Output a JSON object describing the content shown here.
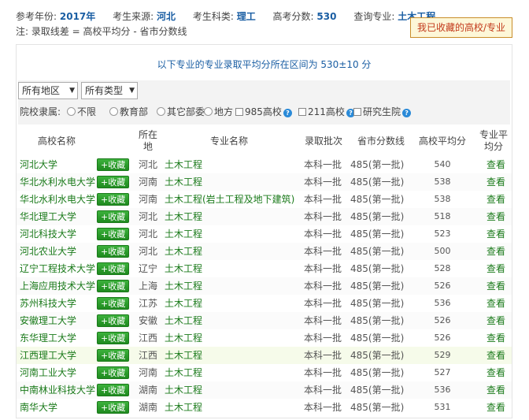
{
  "header": {
    "year_label": "参考年份:",
    "year_value": "2017年",
    "source_label": "考生来源:",
    "source_value": "河北",
    "subject_label": "考生科类:",
    "subject_value": "理工",
    "score_label": "高考分数:",
    "score_value": "530",
    "major_label": "查询专业:",
    "major_value": "土木工程",
    "note": "注: 录取线差 = 高校平均分 - 省市分数线",
    "favorites_button": "我已收藏的高校/专业"
  },
  "notice": "以下专业的专业录取平均分所在区间为  530±10  分",
  "filters": {
    "region_select": "所有地区",
    "type_select": "所有类型",
    "affiliation_label": "院校隶属:",
    "affiliation_options": [
      "不限",
      "教育部",
      "其它部委",
      "地方"
    ],
    "checkbox_985": "985高校",
    "checkbox_211": "211高校",
    "checkbox_grad": "研究生院"
  },
  "table": {
    "headers": {
      "school": "高校名称",
      "location": "所在地",
      "major": "专业名称",
      "batch": "录取批次",
      "province_line": "省市分数线",
      "school_avg": "高校平均分",
      "major_avg": "专业平均分"
    },
    "favorite_label": "+收藏",
    "rows": [
      {
        "school": "河北大学",
        "location": "河北",
        "major": "土木工程",
        "batch": "本科一批",
        "line": "485(第一批)",
        "avg": "540",
        "view": "查看"
      },
      {
        "school": "华北水利水电大学",
        "location": "河南",
        "major": "土木工程",
        "batch": "本科一批",
        "line": "485(第一批)",
        "avg": "538",
        "view": "查看"
      },
      {
        "school": "华北水利水电大学",
        "location": "河南",
        "major": "土木工程(岩土工程及地下建筑)",
        "batch": "本科一批",
        "line": "485(第一批)",
        "avg": "538",
        "view": "查看"
      },
      {
        "school": "华北理工大学",
        "location": "河北",
        "major": "土木工程",
        "batch": "本科一批",
        "line": "485(第一批)",
        "avg": "518",
        "view": "查看"
      },
      {
        "school": "河北科技大学",
        "location": "河北",
        "major": "土木工程",
        "batch": "本科一批",
        "line": "485(第一批)",
        "avg": "523",
        "view": "查看"
      },
      {
        "school": "河北农业大学",
        "location": "河北",
        "major": "土木工程",
        "batch": "本科一批",
        "line": "485(第一批)",
        "avg": "500",
        "view": "查看"
      },
      {
        "school": "辽宁工程技术大学",
        "location": "辽宁",
        "major": "土木工程",
        "batch": "本科一批",
        "line": "485(第一批)",
        "avg": "528",
        "view": "查看"
      },
      {
        "school": "上海应用技术大学",
        "location": "上海",
        "major": "土木工程",
        "batch": "本科一批",
        "line": "485(第一批)",
        "avg": "526",
        "view": "查看"
      },
      {
        "school": "苏州科技大学",
        "location": "江苏",
        "major": "土木工程",
        "batch": "本科一批",
        "line": "485(第一批)",
        "avg": "536",
        "view": "查看"
      },
      {
        "school": "安徽理工大学",
        "location": "安徽",
        "major": "土木工程",
        "batch": "本科一批",
        "line": "485(第一批)",
        "avg": "526",
        "view": "查看"
      },
      {
        "school": "东华理工大学",
        "location": "江西",
        "major": "土木工程",
        "batch": "本科一批",
        "line": "485(第一批)",
        "avg": "526",
        "view": "查看"
      },
      {
        "school": "江西理工大学",
        "location": "江西",
        "major": "土木工程",
        "batch": "本科一批",
        "line": "485(第一批)",
        "avg": "529",
        "view": "查看"
      },
      {
        "school": "河南工业大学",
        "location": "河南",
        "major": "土木工程",
        "batch": "本科一批",
        "line": "485(第一批)",
        "avg": "527",
        "view": "查看"
      },
      {
        "school": "中南林业科技大学",
        "location": "湖南",
        "major": "土木工程",
        "batch": "本科一批",
        "line": "485(第一批)",
        "avg": "536",
        "view": "查看"
      },
      {
        "school": "南华大学",
        "location": "湖南",
        "major": "土木工程",
        "batch": "本科一批",
        "line": "485(第一批)",
        "avg": "531",
        "view": "查看"
      }
    ]
  }
}
